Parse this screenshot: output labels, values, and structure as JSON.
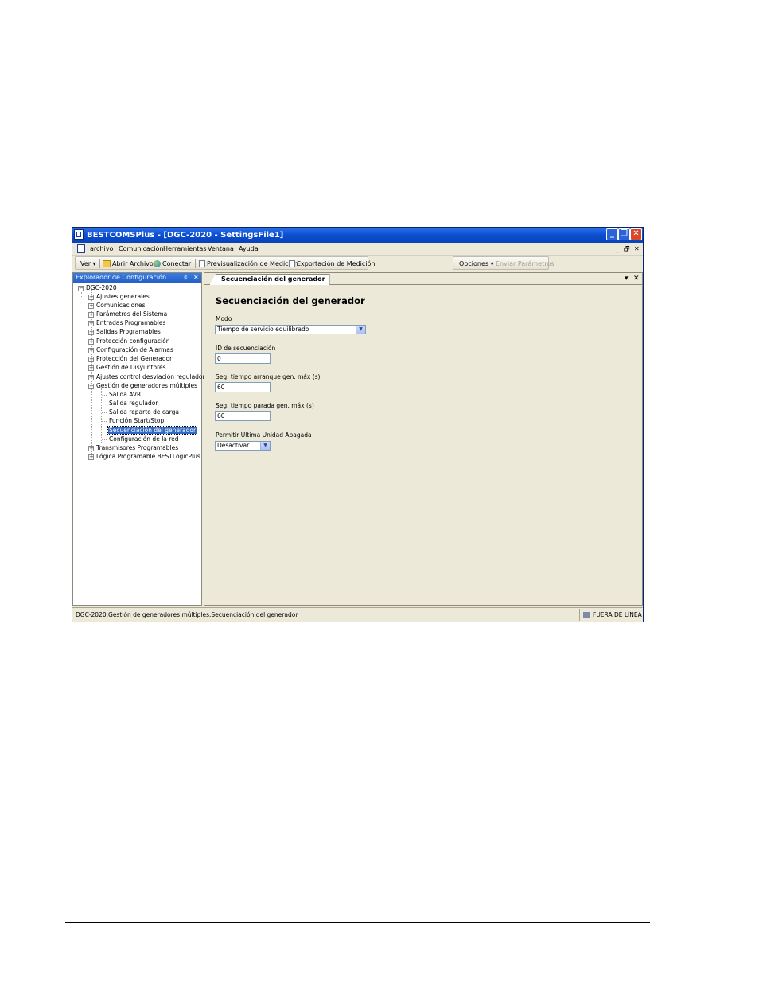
{
  "window": {
    "title": "BESTCOMSPlus - [DGC-2020 - SettingsFile1]",
    "minimize": "_",
    "maximize": "❐",
    "close": "✕"
  },
  "menubar": {
    "items": [
      "archivo",
      "Comunicación",
      "Herramientas",
      "Ventana",
      "Ayuda"
    ],
    "child_minimize": "_",
    "child_restore": "🗗",
    "child_close": "✕"
  },
  "toolbar": {
    "ver": "Ver ▾",
    "abrir": "Abrir Archivo",
    "conectar": "Conectar",
    "previsualizacion": "Previsualización de Medición",
    "exportacion": "Exportación de Medición",
    "opciones": "Opciones ▾",
    "enviar": "Enviar Parámetros"
  },
  "explorer": {
    "title": "Explorador de Configuración",
    "pin": "ᛰ",
    "close": "✕",
    "root": "DGC-2020",
    "items": [
      "Ajustes generales",
      "Comunicaciones",
      "Parámetros del Sistema",
      "Entradas Programables",
      "Salidas Programables",
      "Protección configuración",
      "Configuración de Alarmas",
      "Protección del Generador",
      "Gestión de Disyuntores",
      "Ajustes control desviación regulador",
      "Gestión de generadores múltiples"
    ],
    "subitems": [
      "Salida AVR",
      "Salida regulador",
      "Salida reparto de carga",
      "Función Start/Stop",
      "Secuenciación del generador",
      "Configuración de la red"
    ],
    "items_after": [
      "Transmisores Programables",
      "Lógica Programable BESTLogicPlus"
    ]
  },
  "doc": {
    "tab": "Secuenciación del generador",
    "dropdown": "▾",
    "close": "✕",
    "heading": "Secuenciación del generador",
    "modo_label": "Modo",
    "modo_value": "Tiempo de servicio equilibrado",
    "id_label": "ID de secuenciación",
    "id_value": "0",
    "arranque_label": "Seg. tiempo arranque gen. máx (s)",
    "arranque_value": "60",
    "parada_label": "Seg. tiempo parada gen. máx (s)",
    "parada_value": "60",
    "permitir_label": "Permitir Última Unidad Apagada",
    "permitir_value": "Desactivar"
  },
  "status": {
    "path": "DGC-2020.Gestión de generadores múltiples.Secuenciación del generador",
    "state": "FUERA DE LÍNEA"
  }
}
